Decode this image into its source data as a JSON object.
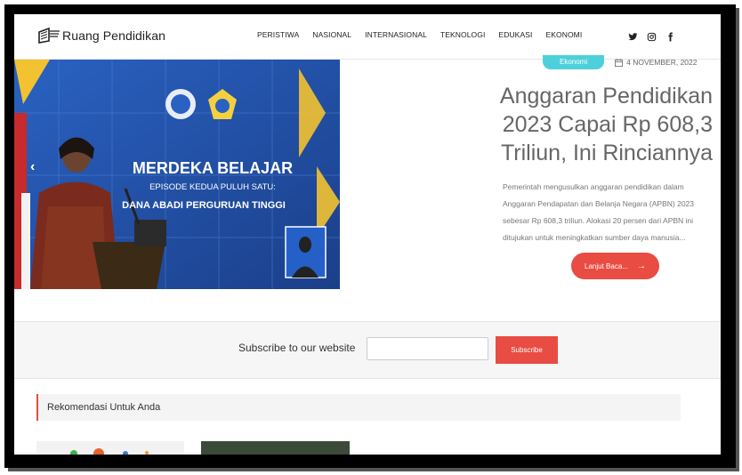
{
  "site": {
    "name": "Ruang Pendidikan"
  },
  "nav": {
    "items": [
      "PERISTIWA",
      "NASIONAL",
      "INTERNASIONAL",
      "TEKNOLOGI",
      "EDUKASI",
      "EKONOMI"
    ]
  },
  "social": {
    "icons": [
      "twitter-icon",
      "instagram-icon",
      "facebook-icon"
    ]
  },
  "hero": {
    "image_text": {
      "line1": "MERDEKA BELAJAR",
      "line2": "EPISODE KEDUA PULUH SATU:",
      "line3": "DANA ABADI PERGURUAN TINGGI"
    },
    "category": "Ekonomi",
    "date": "4 NOVEMBER, 2022",
    "title": "Anggaran Pendidikan 2023 Capai Rp 608,3 Triliun, Ini Rinciannya",
    "excerpt": "Pemerintah mengusulkan anggaran pendidikan dalam Anggaran Pendapatan dan Belanja Negara (APBN) 2023 sebesar Rp 608,3 triliun. Alokasi 20 persen dari APBN ini ditujukan untuk meningkatkan sumber daya manusia...",
    "read_more": "Lanjut Baca...",
    "prev_arrow": "‹"
  },
  "subscribe": {
    "label": "Subscribe to our website",
    "placeholder": "",
    "button": "Subscribe"
  },
  "recommend": {
    "title": "Rekomendasi Untuk Anda"
  },
  "colors": {
    "accent": "#e84c43",
    "badge": "#4ed0da",
    "hero_bg": "#1f4fa6"
  }
}
